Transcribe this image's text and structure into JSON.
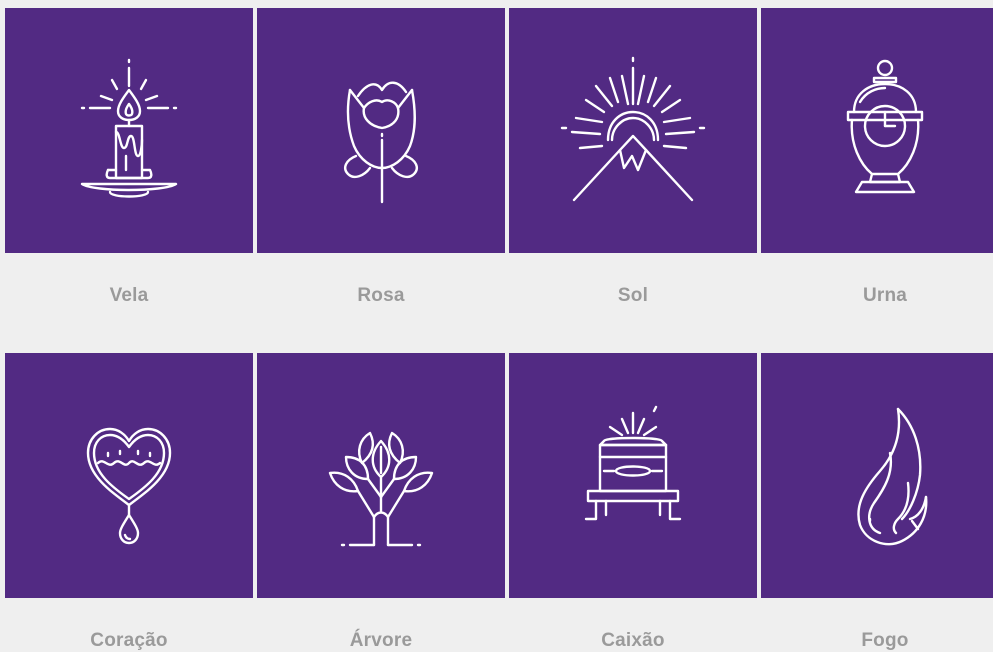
{
  "symbols": [
    {
      "label": "Vela",
      "icon": "candle-icon"
    },
    {
      "label": "Rosa",
      "icon": "rose-icon"
    },
    {
      "label": "Sol",
      "icon": "sun-icon"
    },
    {
      "label": "Urna",
      "icon": "urn-icon"
    },
    {
      "label": "Coração",
      "icon": "heart-icon"
    },
    {
      "label": "Árvore",
      "icon": "tree-icon"
    },
    {
      "label": "Caixão",
      "icon": "coffin-icon"
    },
    {
      "label": "Fogo",
      "icon": "fire-icon"
    }
  ],
  "colors": {
    "tile": "#522a83",
    "background": "#efefef",
    "label": "#9a9a9a",
    "icon_stroke": "#ffffff"
  }
}
